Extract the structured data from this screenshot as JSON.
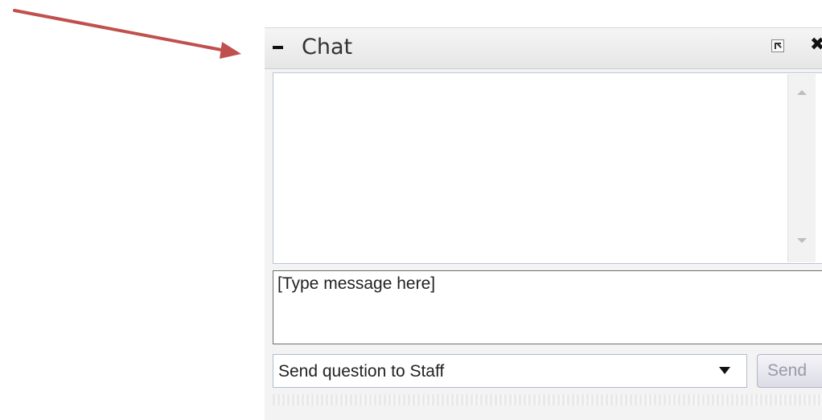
{
  "chat": {
    "title": "Chat",
    "message_input_placeholder": "[Type message here]",
    "recipient_selected": "Send question to Staff",
    "send_label": "Send"
  },
  "icons": {
    "collapse": "minus-icon",
    "popout": "popout-window-icon",
    "close": "close-icon",
    "scroll_up": "scroll-up-arrow-icon",
    "scroll_down": "scroll-down-arrow-icon",
    "dropdown": "chevron-down-icon"
  },
  "colors": {
    "annotation_arrow": "#c0504d"
  }
}
